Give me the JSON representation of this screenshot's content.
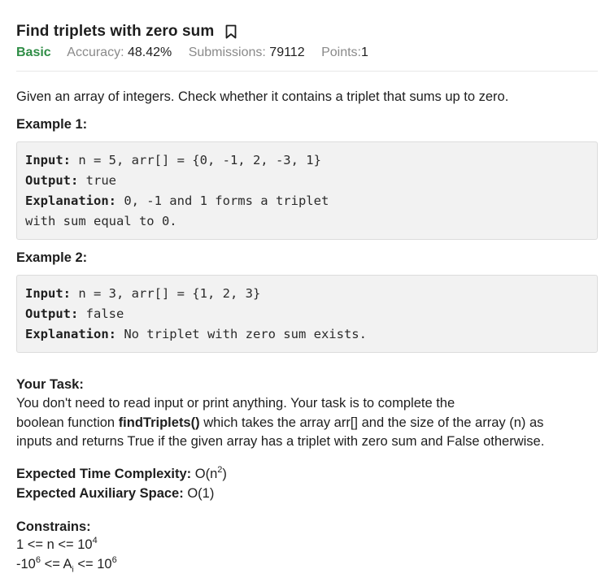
{
  "header": {
    "title": "Find triplets with zero sum",
    "difficulty": "Basic",
    "accuracy_label": "Accuracy:",
    "accuracy_value": "48.42%",
    "submissions_label": "Submissions:",
    "submissions_value": "79112",
    "points_label": "Points:",
    "points_value": "1",
    "bookmark_icon": "bookmark-icon"
  },
  "problem": {
    "statement": "Given an array of integers. Check whether it contains a triplet that sums up to zero.",
    "example1_heading": "Example 1:",
    "example1": {
      "input_key": "Input:",
      "input_value": " n = 5, arr[] = {0, -1, 2, -3, 1}",
      "output_key": "Output:",
      "output_value": " true",
      "explanation_key": "Explanation:",
      "explanation_value": " 0, -1 and 1 forms a triplet",
      "explanation_cont": "with sum equal to 0."
    },
    "example2_heading": "Example 2:",
    "example2": {
      "input_key": "Input:",
      "input_value": " n = 3, arr[] = {1, 2, 3}",
      "output_key": "Output:",
      "output_value": " false",
      "explanation_key": "Explanation:",
      "explanation_value": " No triplet with zero sum exists."
    },
    "task_heading": "Your Task:",
    "task_line1": "You don't need to read input or print anything. Your task is to complete the",
    "task_line2_pre": "boolean function ",
    "task_line2_fn": "findTriplets()",
    "task_line2_post": " which takes the array arr[] and the size of the array (n) as",
    "task_line3": "inputs and returns True if the given array has a triplet with zero sum and False otherwise.",
    "time_label": "Expected Time Complexity:",
    "time_value_pre": " O(n",
    "time_value_sup": "2",
    "time_value_post": ")",
    "space_label": "Expected Auxiliary Space:",
    "space_value": " O(1)",
    "constraints_heading": "Constrains:",
    "c1_pre": "1 <= n <= 10",
    "c1_sup": "4",
    "c2_pre": "-10",
    "c2_sup1": "6",
    "c2_mid": " <= A",
    "c2_sub": "i",
    "c2_mid2": " <= 10",
    "c2_sup2": "6"
  }
}
